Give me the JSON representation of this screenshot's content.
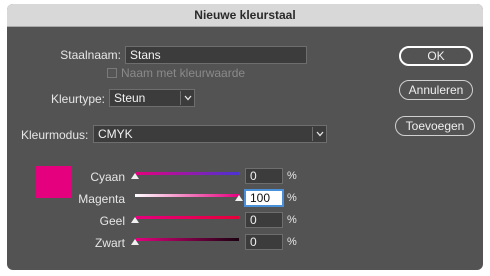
{
  "window": {
    "title": "Nieuwe kleurstaal"
  },
  "form": {
    "name_label": "Staalnaam:",
    "name_value": "Stans",
    "name_with_value_label": "Naam met kleurwaarde",
    "type_label": "Kleurtype:",
    "type_value": "Steun",
    "mode_label": "Kleurmodus:",
    "mode_value": "CMYK"
  },
  "buttons": {
    "ok": "OK",
    "cancel": "Annuleren",
    "add": "Toevoegen"
  },
  "swatch_color": "#e5007e",
  "channels": [
    {
      "label": "Cyaan",
      "value": "0",
      "unit": "%",
      "level": 0,
      "gradient": [
        "#e5007e",
        "#4a33d6"
      ]
    },
    {
      "label": "Magenta",
      "value": "100",
      "unit": "%",
      "level": 1,
      "gradient": [
        "#ffffff",
        "#e5007e"
      ]
    },
    {
      "label": "Geel",
      "value": "0",
      "unit": "%",
      "level": 0,
      "gradient": [
        "#e5007e",
        "#e6003a"
      ]
    },
    {
      "label": "Zwart",
      "value": "0",
      "unit": "%",
      "level": 0,
      "gradient": [
        "#e5007e",
        "#1a0010"
      ]
    }
  ]
}
